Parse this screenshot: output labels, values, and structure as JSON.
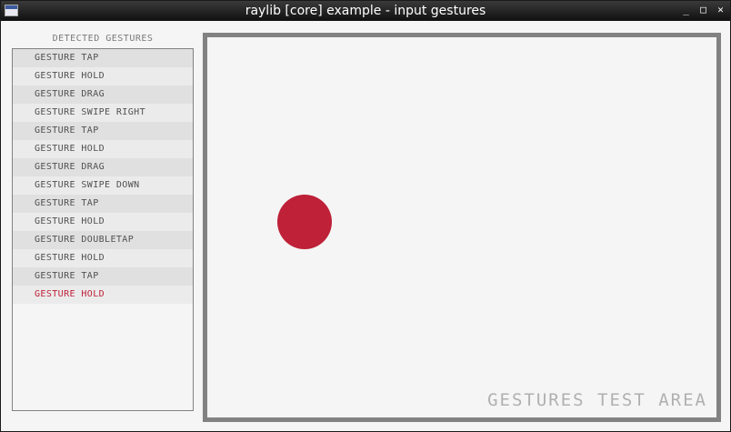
{
  "window": {
    "title": "raylib [core] example - input gestures",
    "controls": {
      "minimize": "_",
      "maximize": "□",
      "close": "✕"
    }
  },
  "gesture_log": {
    "title": "DETECTED GESTURES",
    "entries": [
      "GESTURE TAP",
      "GESTURE HOLD",
      "GESTURE DRAG",
      "GESTURE SWIPE RIGHT",
      "GESTURE TAP",
      "GESTURE HOLD",
      "GESTURE DRAG",
      "GESTURE SWIPE DOWN",
      "GESTURE TAP",
      "GESTURE HOLD",
      "GESTURE DOUBLETAP",
      "GESTURE HOLD",
      "GESTURE TAP",
      "GESTURE HOLD"
    ],
    "latest_color": "#be2138"
  },
  "test_area": {
    "label": "GESTURES TEST AREA",
    "border_color": "#828282",
    "touch_point_color": "#be2138"
  }
}
